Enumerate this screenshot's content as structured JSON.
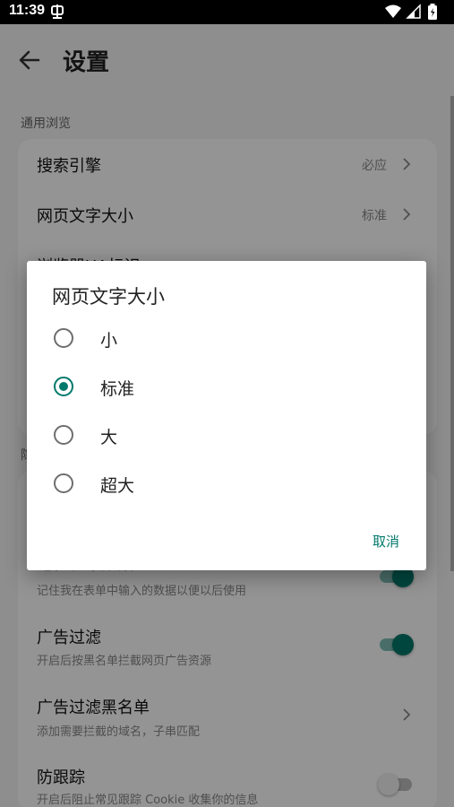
{
  "status_bar": {
    "time": "11:39"
  },
  "app_bar": {
    "title": "设置"
  },
  "sections": [
    {
      "label": "通用浏览",
      "rows": [
        {
          "title": "搜索引擎",
          "value": "必应"
        },
        {
          "title": "网页文字大小",
          "value": "标准"
        },
        {
          "title": "浏览器UA标识"
        }
      ]
    },
    {
      "label": "隐",
      "rows": [
        {
          "title": "记住表单数据",
          "subtitle": "记住我在表单中输入的数据以便以后使用",
          "switch_on": true
        },
        {
          "title": "广告过滤",
          "subtitle": "开启后按黑名单拦截网页广告资源",
          "switch_on": true
        },
        {
          "title": "广告过滤黑名单",
          "subtitle": "添加需要拦截的域名，子串匹配"
        },
        {
          "title": "防跟踪",
          "subtitle": "开启后阻止常见跟踪 Cookie 收集你的信息",
          "switch_on": false
        }
      ]
    }
  ],
  "dialog": {
    "title": "网页文字大小",
    "options": [
      {
        "label": "小",
        "selected": false
      },
      {
        "label": "标准",
        "selected": true
      },
      {
        "label": "大",
        "selected": false
      },
      {
        "label": "超大",
        "selected": false
      }
    ],
    "cancel_label": "取消"
  },
  "colors": {
    "accent": "#00796b",
    "scrim": "rgba(0,0,0,0.42)"
  }
}
